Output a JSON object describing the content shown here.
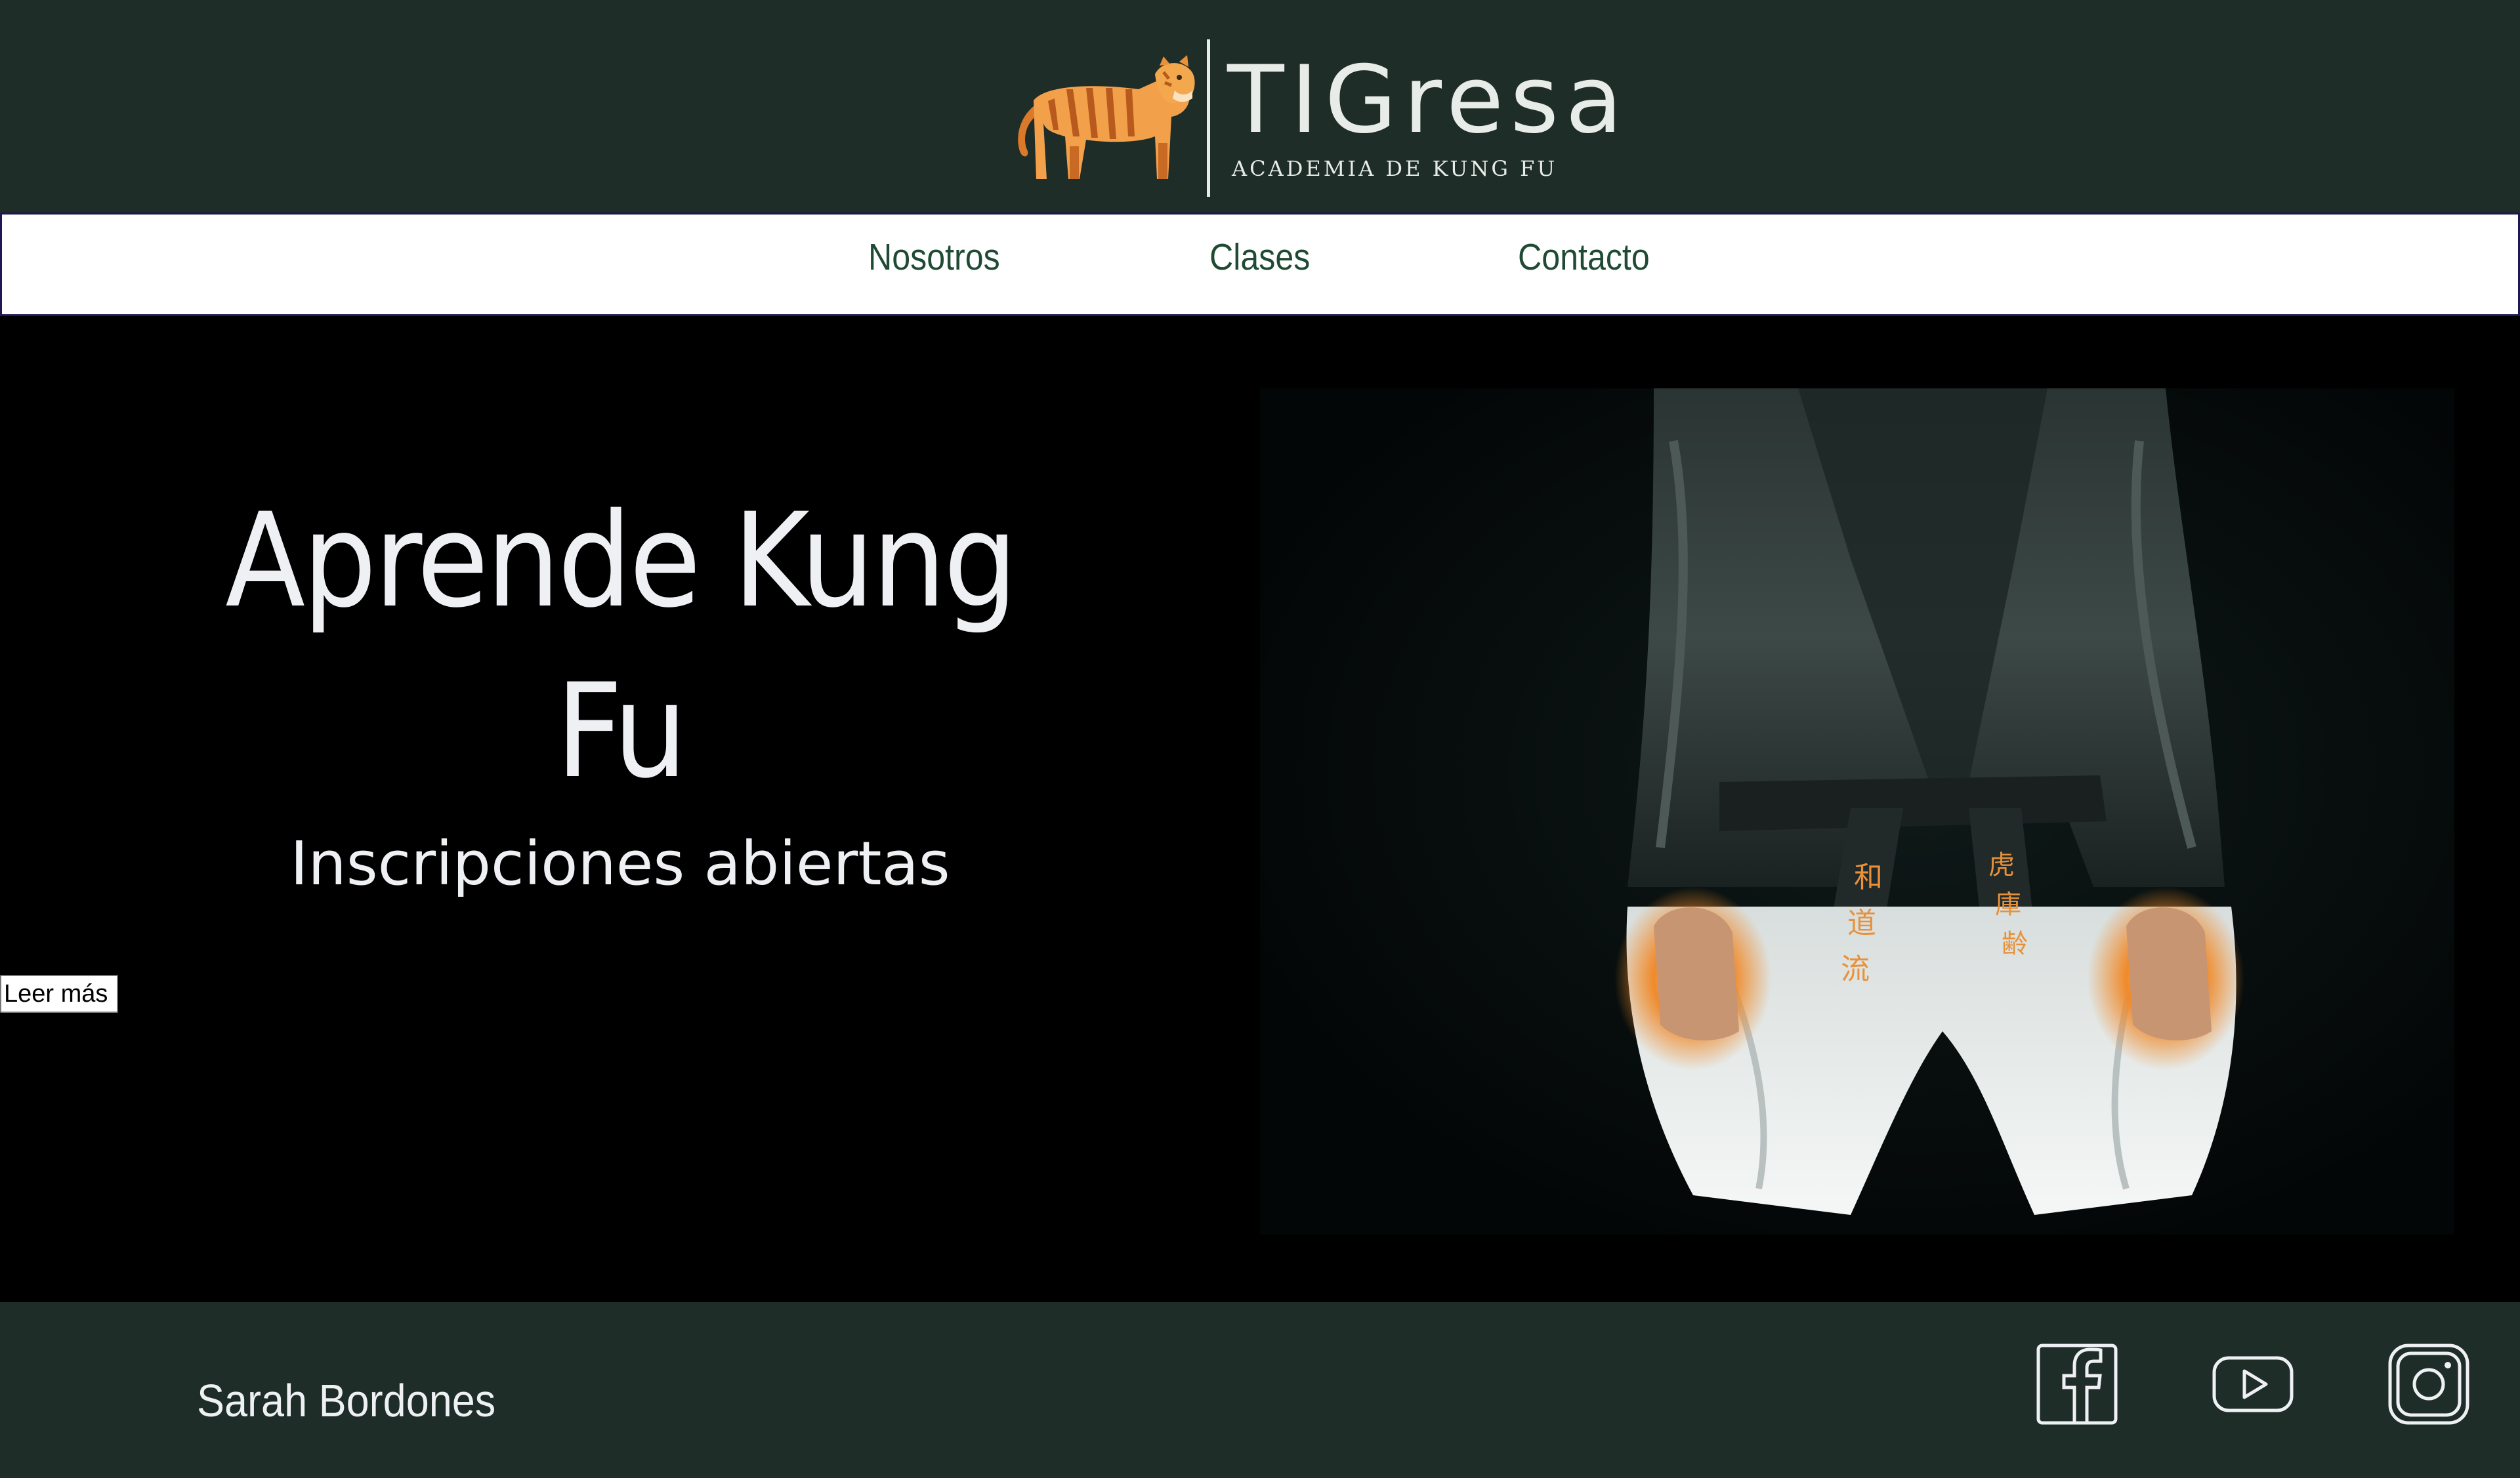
{
  "header": {
    "brand_name": "TIGresa",
    "brand_tagline": "ACADEMIA DE KUNG FU"
  },
  "nav": {
    "items": [
      {
        "label": "Nosotros"
      },
      {
        "label": "Clases"
      },
      {
        "label": "Contacto"
      }
    ]
  },
  "hero": {
    "title_line1": "Aprende Kung",
    "title_line2": "Fu",
    "subtitle": "Inscripciones abiertas",
    "button_label": "Leer más"
  },
  "footer": {
    "author": "Sarah Bordones",
    "social_icons": [
      "facebook-icon",
      "youtube-icon",
      "instagram-icon"
    ]
  },
  "colors": {
    "header_bg": "#1e2d27",
    "nav_text": "#1f4a33",
    "nav_border": "#1f1654",
    "hero_bg": "#000000",
    "accent_orange": "#e8913a"
  }
}
